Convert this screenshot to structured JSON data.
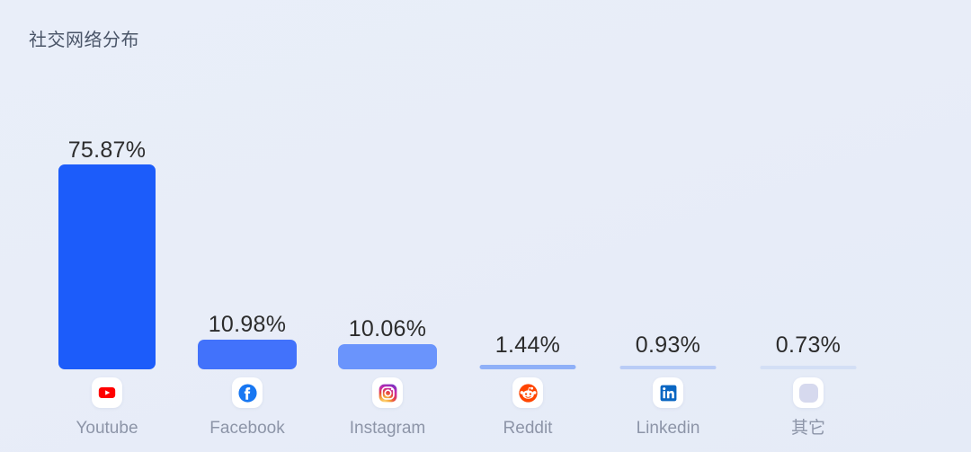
{
  "chart_data": {
    "type": "bar",
    "title": "社交网络分布",
    "xlabel": "",
    "ylabel": "",
    "unit": "%",
    "grid": false,
    "legend": "none",
    "ylim": [
      0,
      75.87
    ],
    "categories": [
      "Youtube",
      "Facebook",
      "Instagram",
      "Reddit",
      "Linkedin",
      "其它"
    ],
    "values": [
      75.87,
      10.98,
      10.06,
      1.44,
      0.93,
      0.73
    ],
    "value_labels": [
      "75.87%",
      "10.98%",
      "10.06%",
      "1.44%",
      "0.93%",
      "0.73%"
    ],
    "bar_colors": [
      "#1c5cfa",
      "#4272fb",
      "#6a94fc",
      "#8fb0f8",
      "#b9ccf6",
      "#d3dff5"
    ],
    "icons": [
      "youtube-icon",
      "facebook-icon",
      "instagram-icon",
      "reddit-icon",
      "linkedin-icon",
      "other-icon"
    ]
  },
  "colors": {
    "background": "#e8edf9",
    "title_text": "#4a5568",
    "value_text": "#2c2c2c",
    "category_text": "#8d95a8",
    "accent": "#1c5cfa",
    "youtube_red": "#ff0000",
    "facebook_blue": "#1877f2",
    "reddit_orange": "#ff4500",
    "linkedin_blue": "#0a66c2",
    "other_placeholder": "#d6d9ee"
  }
}
